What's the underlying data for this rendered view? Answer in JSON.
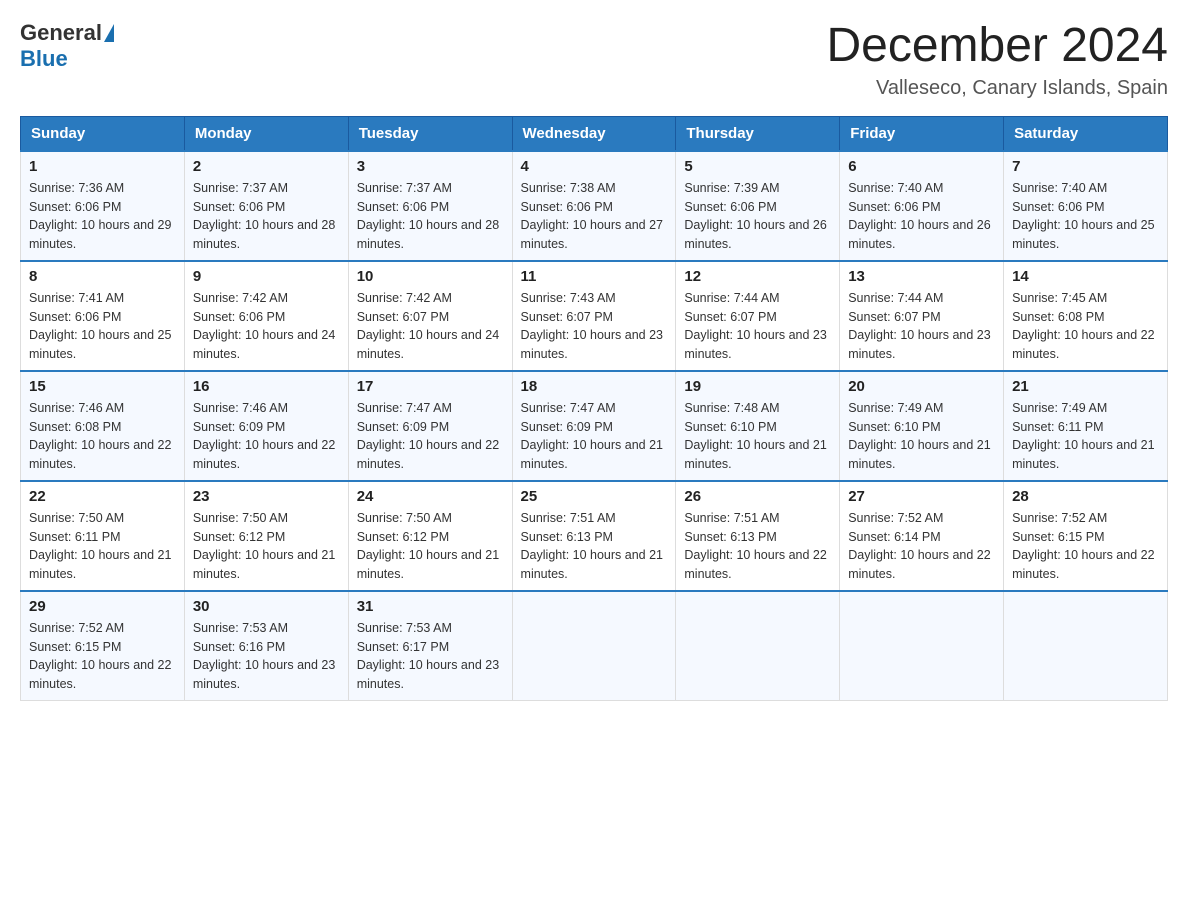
{
  "header": {
    "logo_general": "General",
    "logo_blue": "Blue",
    "month_title": "December 2024",
    "subtitle": "Valleseco, Canary Islands, Spain"
  },
  "columns": [
    "Sunday",
    "Monday",
    "Tuesday",
    "Wednesday",
    "Thursday",
    "Friday",
    "Saturday"
  ],
  "weeks": [
    [
      {
        "day": "1",
        "sunrise": "7:36 AM",
        "sunset": "6:06 PM",
        "daylight": "10 hours and 29 minutes."
      },
      {
        "day": "2",
        "sunrise": "7:37 AM",
        "sunset": "6:06 PM",
        "daylight": "10 hours and 28 minutes."
      },
      {
        "day": "3",
        "sunrise": "7:37 AM",
        "sunset": "6:06 PM",
        "daylight": "10 hours and 28 minutes."
      },
      {
        "day": "4",
        "sunrise": "7:38 AM",
        "sunset": "6:06 PM",
        "daylight": "10 hours and 27 minutes."
      },
      {
        "day": "5",
        "sunrise": "7:39 AM",
        "sunset": "6:06 PM",
        "daylight": "10 hours and 26 minutes."
      },
      {
        "day": "6",
        "sunrise": "7:40 AM",
        "sunset": "6:06 PM",
        "daylight": "10 hours and 26 minutes."
      },
      {
        "day": "7",
        "sunrise": "7:40 AM",
        "sunset": "6:06 PM",
        "daylight": "10 hours and 25 minutes."
      }
    ],
    [
      {
        "day": "8",
        "sunrise": "7:41 AM",
        "sunset": "6:06 PM",
        "daylight": "10 hours and 25 minutes."
      },
      {
        "day": "9",
        "sunrise": "7:42 AM",
        "sunset": "6:06 PM",
        "daylight": "10 hours and 24 minutes."
      },
      {
        "day": "10",
        "sunrise": "7:42 AM",
        "sunset": "6:07 PM",
        "daylight": "10 hours and 24 minutes."
      },
      {
        "day": "11",
        "sunrise": "7:43 AM",
        "sunset": "6:07 PM",
        "daylight": "10 hours and 23 minutes."
      },
      {
        "day": "12",
        "sunrise": "7:44 AM",
        "sunset": "6:07 PM",
        "daylight": "10 hours and 23 minutes."
      },
      {
        "day": "13",
        "sunrise": "7:44 AM",
        "sunset": "6:07 PM",
        "daylight": "10 hours and 23 minutes."
      },
      {
        "day": "14",
        "sunrise": "7:45 AM",
        "sunset": "6:08 PM",
        "daylight": "10 hours and 22 minutes."
      }
    ],
    [
      {
        "day": "15",
        "sunrise": "7:46 AM",
        "sunset": "6:08 PM",
        "daylight": "10 hours and 22 minutes."
      },
      {
        "day": "16",
        "sunrise": "7:46 AM",
        "sunset": "6:09 PM",
        "daylight": "10 hours and 22 minutes."
      },
      {
        "day": "17",
        "sunrise": "7:47 AM",
        "sunset": "6:09 PM",
        "daylight": "10 hours and 22 minutes."
      },
      {
        "day": "18",
        "sunrise": "7:47 AM",
        "sunset": "6:09 PM",
        "daylight": "10 hours and 21 minutes."
      },
      {
        "day": "19",
        "sunrise": "7:48 AM",
        "sunset": "6:10 PM",
        "daylight": "10 hours and 21 minutes."
      },
      {
        "day": "20",
        "sunrise": "7:49 AM",
        "sunset": "6:10 PM",
        "daylight": "10 hours and 21 minutes."
      },
      {
        "day": "21",
        "sunrise": "7:49 AM",
        "sunset": "6:11 PM",
        "daylight": "10 hours and 21 minutes."
      }
    ],
    [
      {
        "day": "22",
        "sunrise": "7:50 AM",
        "sunset": "6:11 PM",
        "daylight": "10 hours and 21 minutes."
      },
      {
        "day": "23",
        "sunrise": "7:50 AM",
        "sunset": "6:12 PM",
        "daylight": "10 hours and 21 minutes."
      },
      {
        "day": "24",
        "sunrise": "7:50 AM",
        "sunset": "6:12 PM",
        "daylight": "10 hours and 21 minutes."
      },
      {
        "day": "25",
        "sunrise": "7:51 AM",
        "sunset": "6:13 PM",
        "daylight": "10 hours and 21 minutes."
      },
      {
        "day": "26",
        "sunrise": "7:51 AM",
        "sunset": "6:13 PM",
        "daylight": "10 hours and 22 minutes."
      },
      {
        "day": "27",
        "sunrise": "7:52 AM",
        "sunset": "6:14 PM",
        "daylight": "10 hours and 22 minutes."
      },
      {
        "day": "28",
        "sunrise": "7:52 AM",
        "sunset": "6:15 PM",
        "daylight": "10 hours and 22 minutes."
      }
    ],
    [
      {
        "day": "29",
        "sunrise": "7:52 AM",
        "sunset": "6:15 PM",
        "daylight": "10 hours and 22 minutes."
      },
      {
        "day": "30",
        "sunrise": "7:53 AM",
        "sunset": "6:16 PM",
        "daylight": "10 hours and 23 minutes."
      },
      {
        "day": "31",
        "sunrise": "7:53 AM",
        "sunset": "6:17 PM",
        "daylight": "10 hours and 23 minutes."
      },
      null,
      null,
      null,
      null
    ]
  ],
  "labels": {
    "sunrise": "Sunrise:",
    "sunset": "Sunset:",
    "daylight": "Daylight:"
  }
}
